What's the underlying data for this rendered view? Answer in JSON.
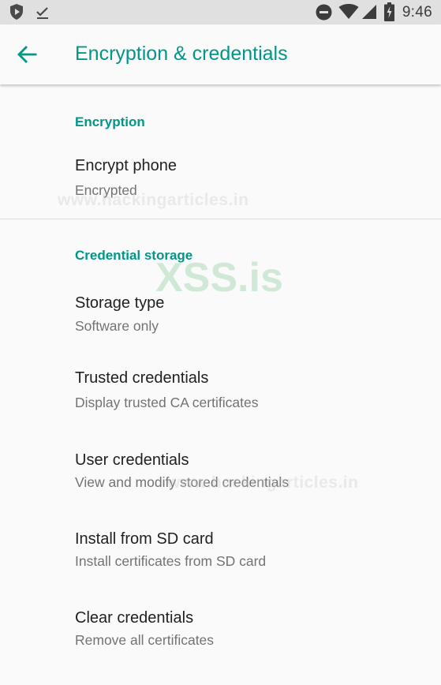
{
  "status_bar": {
    "time": "9:46",
    "left_icons": [
      "shield-play-icon",
      "checkmark-icon"
    ],
    "right_icons": [
      "do-not-disturb-icon",
      "wifi-icon",
      "cellular-signal-icon",
      "battery-charging-icon"
    ]
  },
  "app_bar": {
    "back_icon": "arrow-back-icon",
    "title": "Encryption & credentials"
  },
  "sections": {
    "encryption": {
      "header": "Encryption",
      "items": [
        {
          "title": "Encrypt phone",
          "summary": "Encrypted"
        }
      ]
    },
    "credential_storage": {
      "header": "Credential storage",
      "items": [
        {
          "title": "Storage type",
          "summary": "Software only"
        },
        {
          "title": "Trusted credentials",
          "summary": "Display trusted CA certificates"
        },
        {
          "title": "User credentials",
          "summary": "View and modify stored credentials"
        },
        {
          "title": "Install from SD card",
          "summary": "Install certificates from SD card"
        },
        {
          "title": "Clear credentials",
          "summary": "Remove all certificates"
        }
      ]
    }
  },
  "watermarks": {
    "primary": "XSS.is",
    "secondary": "www.hackingarticles.in",
    "tertiary": "www.hackingarticles.in"
  },
  "colors": {
    "accent": "#009688",
    "status_bar_bg": "#e0e0e0",
    "background": "#fafafa",
    "title_text": "#212121",
    "summary_text": "#737373"
  }
}
